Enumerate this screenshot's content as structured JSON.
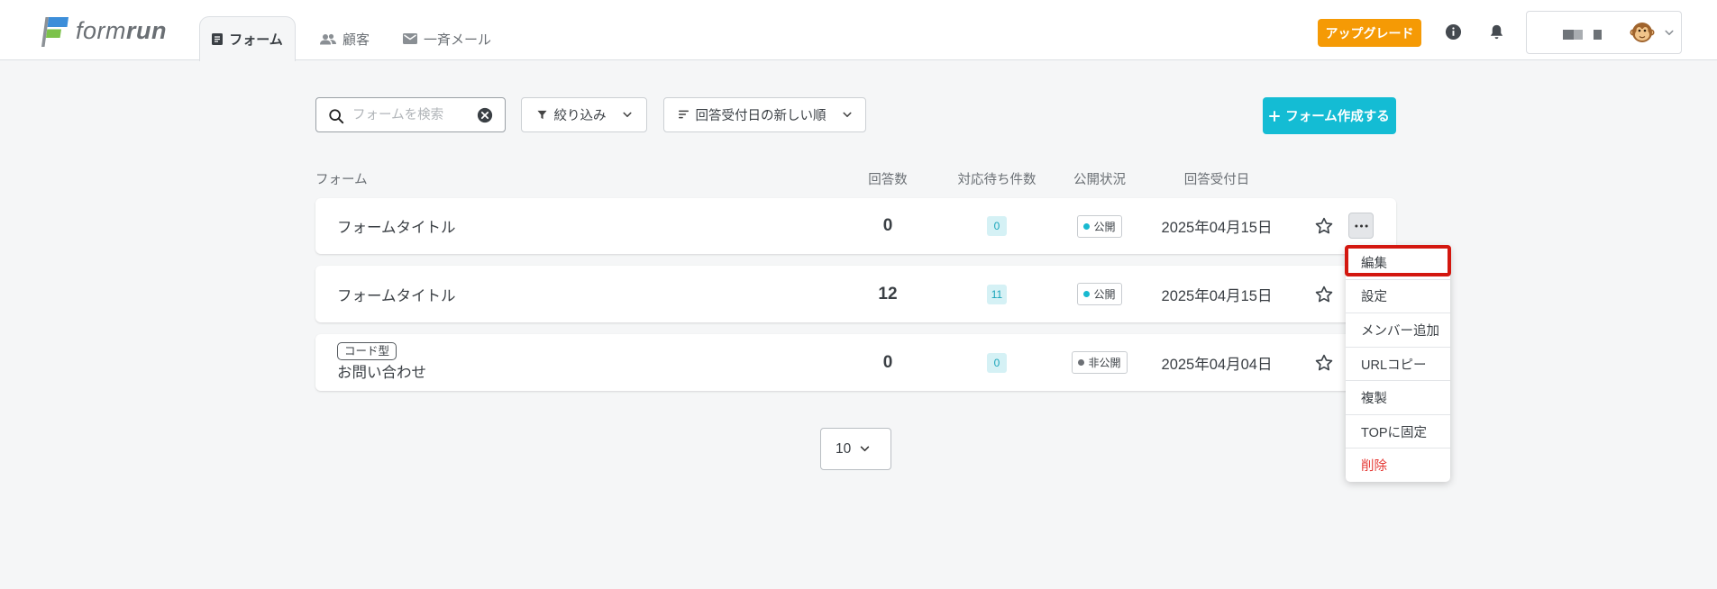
{
  "brand": {
    "logo_regular": "form",
    "logo_bold": "run",
    "logo_icon": "formrun-flag-logo"
  },
  "nav": {
    "tabs": [
      {
        "label": "フォーム",
        "icon": "form-icon",
        "active": true
      },
      {
        "label": "顧客",
        "icon": "people-icon",
        "active": false
      },
      {
        "label": "一斉メール",
        "icon": "mail-icon",
        "active": false
      }
    ]
  },
  "header": {
    "upgrade_label": "アップグレード",
    "info_icon": "info-icon",
    "notification_icon": "bell-icon",
    "account": {
      "avatar": "monkey-avatar",
      "menu_icon": "chevron-down-icon"
    }
  },
  "toolbar": {
    "search": {
      "placeholder": "フォームを検索",
      "value": "",
      "icon": "search-icon",
      "clear_icon": "clear-icon"
    },
    "filter_label": "絞り込み",
    "sort_label": "回答受付日の新しい順",
    "create_label": "フォーム作成する"
  },
  "table": {
    "columns": {
      "form": "フォーム",
      "responses": "回答数",
      "pending": "対応待ち件数",
      "status": "公開状況",
      "date": "回答受付日"
    },
    "rows": [
      {
        "title": "フォームタイトル",
        "tag": "",
        "responses": "0",
        "pending": "0",
        "status": "公開",
        "published": true,
        "date": "2025年04月15日",
        "starred": false
      },
      {
        "title": "フォームタイトル",
        "tag": "",
        "responses": "12",
        "pending": "11",
        "status": "公開",
        "published": true,
        "date": "2025年04月15日",
        "starred": false
      },
      {
        "title": "お問い合わせ",
        "tag": "コード型",
        "responses": "0",
        "pending": "0",
        "status": "非公開",
        "published": false,
        "date": "2025年04月04日",
        "starred": false
      }
    ]
  },
  "row_menu": {
    "items": [
      {
        "label": "編集",
        "danger": false
      },
      {
        "label": "設定",
        "danger": false
      },
      {
        "label": "メンバー追加",
        "danger": false
      },
      {
        "label": "URLコピー",
        "danger": false
      },
      {
        "label": "複製",
        "danger": false
      },
      {
        "label": "TOPに固定",
        "danger": false
      },
      {
        "label": "削除",
        "danger": true
      }
    ]
  },
  "pagination": {
    "per_page": "10"
  },
  "colors": {
    "accent": "#14bcd4",
    "upgrade": "#f59a05",
    "danger": "#e53935",
    "highlight": "#d3170f",
    "badge_bg": "#d5f1f5",
    "badge_text": "#1aa5ba",
    "public_dot": "#18b9d0",
    "private_dot": "#6c7075",
    "page_bg": "#f5f6f7"
  }
}
